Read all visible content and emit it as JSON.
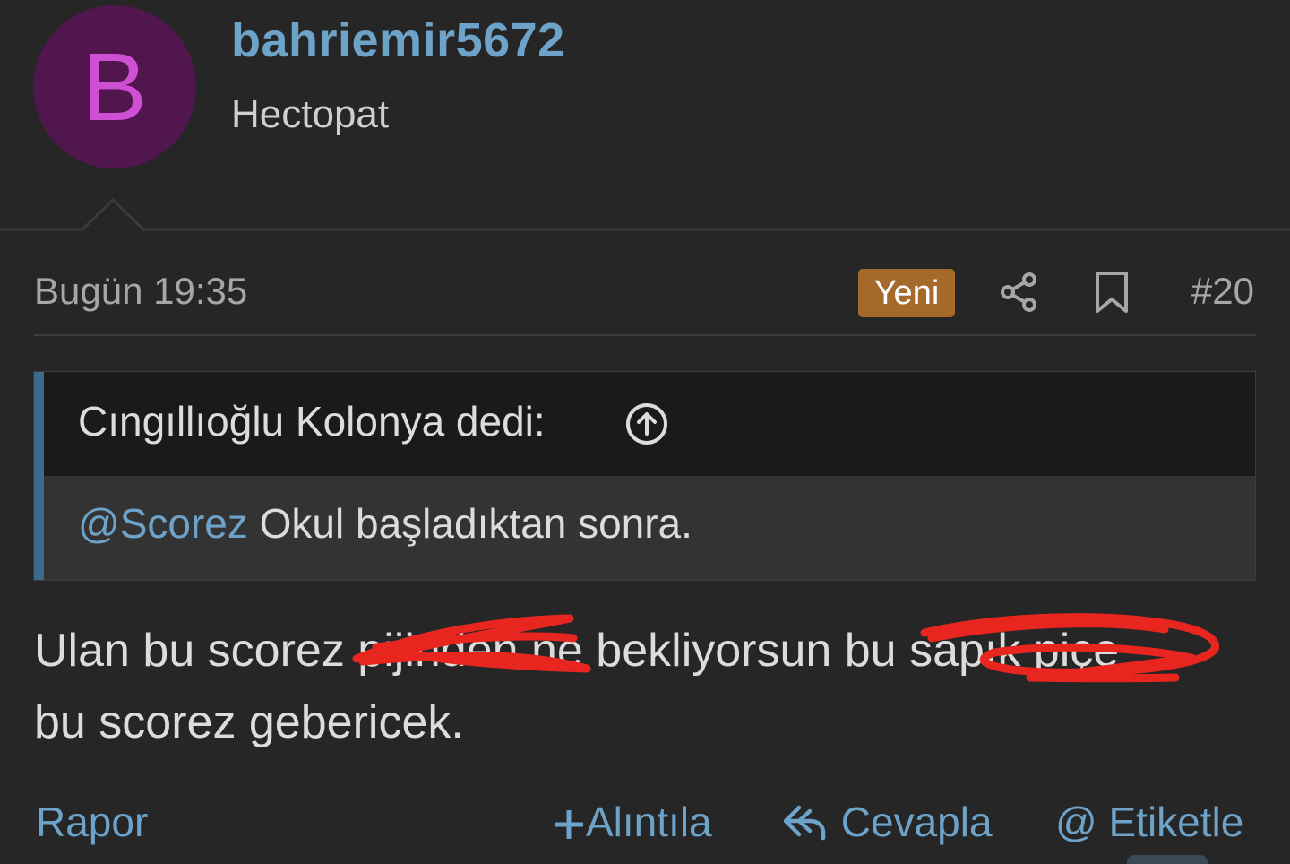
{
  "post": {
    "author": {
      "initial": "B",
      "username": "bahriemir5672",
      "title": "Hectopat"
    },
    "meta": {
      "date": "Bugün 19:35",
      "badge": "Yeni",
      "number": "#20",
      "share_icon": "share-icon",
      "bookmark_icon": "bookmark-icon"
    },
    "quote": {
      "author_line": "Cıngıllıoğlu Kolonya dedi:",
      "up_icon": "arrow-up-circle-icon",
      "mention": "@Scorez",
      "text": " Okul başladıktan sonra."
    },
    "body": {
      "line1_part1": "Ulan bu scorez ",
      "line1_redacted1": "pijinden",
      "line1_part2": " ne bekliyorsun bu ",
      "line1_redacted2": "sapık piçe",
      "line2": "bu scorez gebericek."
    },
    "actions": {
      "report": "Rapor",
      "quote_label": "Alıntıla",
      "reply": "Cevapla",
      "tag": "Etiketle"
    }
  },
  "colors": {
    "background": "#262626",
    "link": "#6ea3c9",
    "avatar_bg": "#52164f",
    "avatar_letter": "#cf4fd4",
    "badge_bg": "#a5692a",
    "quote_bar": "#3c6a8c",
    "redaction": "#e8261f"
  }
}
